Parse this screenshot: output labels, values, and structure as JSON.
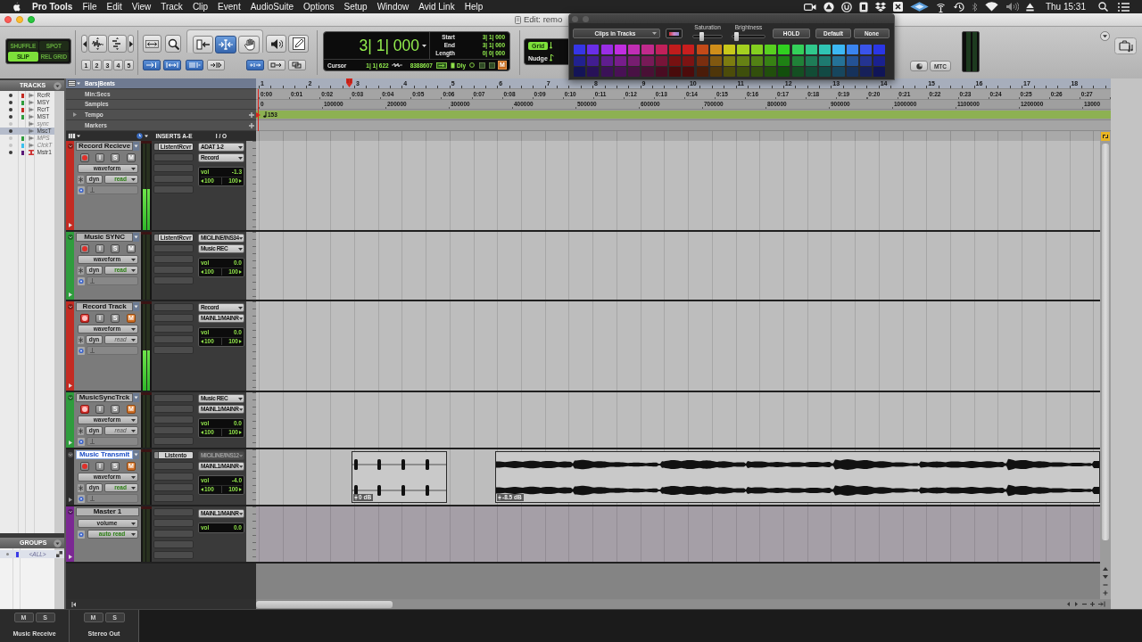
{
  "menu_bar": {
    "app": "Pro Tools",
    "items": [
      "File",
      "Edit",
      "View",
      "Track",
      "Clip",
      "Event",
      "AudioSuite",
      "Options",
      "Setup",
      "Window",
      "Avid Link",
      "Help"
    ],
    "clock": "Thu 15:31"
  },
  "window": {
    "title": "Edit: remo"
  },
  "toolbar": {
    "edit_modes": [
      {
        "label": "SHUFFLE",
        "selected": false
      },
      {
        "label": "SPOT",
        "selected": false
      },
      {
        "label": "SLIP",
        "selected": true
      },
      {
        "label": "REL GRID",
        "selected": false
      }
    ],
    "zoom_presets": [
      "1",
      "2",
      "3",
      "4",
      "5"
    ],
    "tools": [
      {
        "kind": "zoom",
        "selected": false
      },
      {
        "kind": "trim",
        "selected": false
      },
      {
        "kind": "select",
        "selected": true
      },
      {
        "kind": "grab",
        "selected": false
      },
      {
        "kind": "scrub",
        "selected": false
      },
      {
        "kind": "pencil",
        "selected": false
      }
    ],
    "edit_options": [
      {
        "kind": "tab",
        "on": true
      },
      {
        "kind": "link",
        "on": true
      },
      {
        "kind": "mirror",
        "on": true
      },
      {
        "kind": "insert",
        "on": false
      },
      {
        "kind": "keyboard",
        "on": true
      },
      {
        "kind": "loop",
        "on": false
      },
      {
        "kind": "group",
        "on": false
      }
    ],
    "counter": {
      "main": "3| 1| 000",
      "rows": [
        {
          "label": "Start",
          "value": "3| 1| 000"
        },
        {
          "label": "End",
          "value": "3| 1| 000"
        },
        {
          "label": "Length",
          "value": "0| 0| 000"
        }
      ],
      "cursor_label": "Cursor",
      "cursor": "1| 1| 622",
      "samples": "8388607",
      "delay": "Dly",
      "mute": "M"
    },
    "grid": {
      "label": "Grid",
      "on": true
    },
    "nudge": {
      "label": "Nudge"
    },
    "sync": "MTC"
  },
  "color_palette": {
    "target": "Clips in Tracks",
    "sliders": [
      {
        "label": "Saturation",
        "level": 0.25
      },
      {
        "label": "Brightness",
        "level": 0.07
      }
    ],
    "buttons": [
      "HOLD",
      "Default",
      "None"
    ],
    "swatches": [
      {
        "color": "#3535e6"
      },
      {
        "color": "#6a2ee8"
      },
      {
        "color": "#9a2ee6"
      },
      {
        "color": "#c02ee0"
      },
      {
        "color": "#c02eb4"
      },
      {
        "color": "#c02a8c"
      },
      {
        "color": "#c0205a"
      },
      {
        "color": "#c01c1c"
      },
      {
        "color": "#c81e1e"
      },
      {
        "color": "#c44a18"
      },
      {
        "color": "#d08e1a"
      },
      {
        "color": "#c8c81a"
      },
      {
        "color": "#a4d020"
      },
      {
        "color": "#84d020"
      },
      {
        "color": "#58d020"
      },
      {
        "color": "#30d020"
      },
      {
        "color": "#34d05a"
      },
      {
        "color": "#30c88c"
      },
      {
        "color": "#30c4b4"
      },
      {
        "color": "#3cb8f4"
      },
      {
        "color": "#3a84f0"
      },
      {
        "color": "#3a54ea"
      },
      {
        "color": "#2a36e6"
      },
      {
        "color": "#21218f"
      },
      {
        "color": "#421d90"
      },
      {
        "color": "#5f1d8f"
      },
      {
        "color": "#771d8b"
      },
      {
        "color": "#771d70"
      },
      {
        "color": "#771a57"
      },
      {
        "color": "#771438"
      },
      {
        "color": "#771111"
      },
      {
        "color": "#7c1313"
      },
      {
        "color": "#7a2e0f"
      },
      {
        "color": "#815810"
      },
      {
        "color": "#7c7c10"
      },
      {
        "color": "#668114"
      },
      {
        "color": "#528114"
      },
      {
        "color": "#378114"
      },
      {
        "color": "#1e8114"
      },
      {
        "color": "#208138"
      },
      {
        "color": "#1e7c57"
      },
      {
        "color": "#1e7a70"
      },
      {
        "color": "#257297"
      },
      {
        "color": "#245295"
      },
      {
        "color": "#243491"
      },
      {
        "color": "#1a218f"
      },
      {
        "color": "#141457"
      },
      {
        "color": "#281158"
      },
      {
        "color": "#3b1157"
      },
      {
        "color": "#491155"
      },
      {
        "color": "#491144"
      },
      {
        "color": "#491035"
      },
      {
        "color": "#490c22"
      },
      {
        "color": "#490b0b"
      },
      {
        "color": "#4c0b0b"
      },
      {
        "color": "#4a1c09"
      },
      {
        "color": "#4f360a"
      },
      {
        "color": "#4c4c0a"
      },
      {
        "color": "#3e4f0c"
      },
      {
        "color": "#324f0c"
      },
      {
        "color": "#214f0c"
      },
      {
        "color": "#124f0c"
      },
      {
        "color": "#144f22"
      },
      {
        "color": "#124c35"
      },
      {
        "color": "#124a44"
      },
      {
        "color": "#17465d"
      },
      {
        "color": "#16325b"
      },
      {
        "color": "#162059"
      },
      {
        "color": "#101557"
      }
    ]
  },
  "tracks_panel": {
    "title": "TRACKS",
    "items": [
      {
        "kind": "audio",
        "name": "RcrR",
        "color": "#c42b22",
        "shown": true,
        "selected": false
      },
      {
        "kind": "audio",
        "name": "MSY",
        "color": "#2f9c3d",
        "shown": true,
        "selected": false
      },
      {
        "kind": "audio",
        "name": "RcrT",
        "color": "#c42b22",
        "shown": true,
        "selected": false
      },
      {
        "kind": "audio",
        "name": "MST",
        "color": "#2f9c3d",
        "shown": true,
        "selected": false
      },
      {
        "kind": "audio",
        "name": "sync",
        "shown": false,
        "selected": false
      },
      {
        "kind": "audio",
        "name": "MscT",
        "shown": true,
        "selected": true
      },
      {
        "kind": "audio",
        "name": "MPS",
        "color": "#2f9c3d",
        "shown": false,
        "selected": false
      },
      {
        "kind": "audio",
        "name": "ClckT",
        "color": "#3cc0ee",
        "shown": false,
        "selected": false
      },
      {
        "kind": "master",
        "name": "Mstr1",
        "color": "#5a1a78",
        "shown": true,
        "selected": false
      }
    ]
  },
  "groups_panel": {
    "title": "GROUPS",
    "items": [
      {
        "name": "<ALL>",
        "color": "#3c3ce6"
      }
    ]
  },
  "rulers": [
    {
      "kind": "bars",
      "name": "Bars|Beats",
      "labels": [
        "1",
        "2",
        "3",
        "4",
        "5",
        "6",
        "7",
        "8",
        "9",
        "10",
        "11",
        "12",
        "13",
        "14",
        "15",
        "16",
        "17",
        "18"
      ]
    },
    {
      "kind": "time",
      "name": "Min:Secs",
      "labels": [
        "0:00",
        "0:01",
        "0:02",
        "0:03",
        "0:04",
        "0:05",
        "0:06",
        "0:07",
        "0:08",
        "0:09",
        "0:10",
        "0:11",
        "0:12",
        "0:13",
        "0:14",
        "0:15",
        "0:16",
        "0:17",
        "0:18",
        "0:19",
        "0:20",
        "0:21",
        "0:22",
        "0:23",
        "0:24",
        "0:25",
        "0:26",
        "0:27"
      ]
    },
    {
      "kind": "samples",
      "name": "Samples",
      "labels": [
        "0",
        "100000",
        "200000",
        "300000",
        "400000",
        "500000",
        "600000",
        "700000",
        "800000",
        "900000",
        "1000000",
        "1100000",
        "1200000",
        "13000"
      ]
    },
    {
      "kind": "tempo",
      "name": "Tempo",
      "labels": [
        "153"
      ]
    },
    {
      "kind": "markers",
      "name": "Markers"
    }
  ],
  "track_columns": {
    "inserts": "INSERTS A-E",
    "io": "I / O"
  },
  "tracks": [
    {
      "kind": "audio",
      "name": "Record Recieve",
      "color": "#c42b22",
      "editing": false,
      "record_armed": false,
      "input_button": "I",
      "solo_button": "S",
      "mute_button": "M",
      "muted": false,
      "view": "waveform",
      "voice": "dyn",
      "automation": "read",
      "automation_on": true,
      "level": 0.47,
      "inserts": [
        "ListentRcvr"
      ],
      "input": "ADAT 1-2",
      "input_active": true,
      "output": "Record",
      "volume_label": "vol",
      "volume": "-1.3",
      "pan": [
        "100",
        "100"
      ]
    },
    {
      "kind": "audio",
      "name": "Music SYNC",
      "color": "#2f9c3d",
      "editing": false,
      "record_armed": false,
      "input_button": "I",
      "solo_button": "S",
      "mute_button": "M",
      "muted": false,
      "view": "waveform",
      "voice": "dyn",
      "automation": "read",
      "automation_on": true,
      "inserts": [
        "ListentRcvr"
      ],
      "input": "MIC/LINE/INS34",
      "input_active": true,
      "output": "Music REC",
      "volume_label": "vol",
      "volume": "0.0",
      "pan": [
        "100",
        "100"
      ]
    },
    {
      "kind": "audio",
      "name": "Record Track",
      "color": "#c42b22",
      "editing": false,
      "record_armed": true,
      "input_button": "I",
      "solo_button": "S",
      "mute_button": "M",
      "muted": true,
      "view": "waveform",
      "voice": "dyn",
      "automation": "read",
      "automation_on": false,
      "level": 0.46,
      "input": "Record",
      "input_active": true,
      "output": "MAINL1/MAINR",
      "volume_label": "vol",
      "volume": "0.0",
      "pan": [
        "100",
        "100"
      ]
    },
    {
      "kind": "audio",
      "name": "MusicSyncTrck",
      "color": "#2f9c3d",
      "editing": false,
      "record_armed": true,
      "input_button": "I",
      "solo_button": "S",
      "mute_button": "M",
      "muted": true,
      "view": "waveform",
      "voice": "dyn",
      "automation": "read",
      "automation_on": false,
      "input": "Music REC",
      "input_active": true,
      "output": "MAINL1/MAINR",
      "volume_label": "vol",
      "volume": "0.0",
      "pan": [
        "100",
        "100"
      ]
    },
    {
      "kind": "audio",
      "name": "Music Transmit",
      "editing": true,
      "record_armed": false,
      "input_button": "I",
      "solo_button": "S",
      "mute_button": "M",
      "muted": true,
      "view": "waveform",
      "voice": "dyn",
      "automation": "read",
      "automation_on": true,
      "inserts": [
        "Listento"
      ],
      "input": "MIC/LINE/INS12",
      "input_active": false,
      "output": "MAINL1/MAINR",
      "volume_label": "vol",
      "volume": "-4.0",
      "pan": [
        "100",
        "100"
      ],
      "clips": [
        {
          "kind": "clicks",
          "gain": "0 dB"
        },
        {
          "kind": "audio",
          "gain": "-8.5 dB"
        }
      ]
    },
    {
      "kind": "master",
      "name": "Master 1",
      "color": "#7b2893",
      "editing": false,
      "view": "volume",
      "automation": "auto read",
      "automation_on": true,
      "output": "MAINL1/MAINR",
      "volume_label": "vol",
      "volume": "0.0"
    }
  ],
  "bottom_bar": {
    "strips": [
      {
        "name": "Music Receive",
        "mute": "M",
        "solo": "S"
      },
      {
        "name": "Stereo Out",
        "mute": "M",
        "solo": "S"
      }
    ]
  }
}
